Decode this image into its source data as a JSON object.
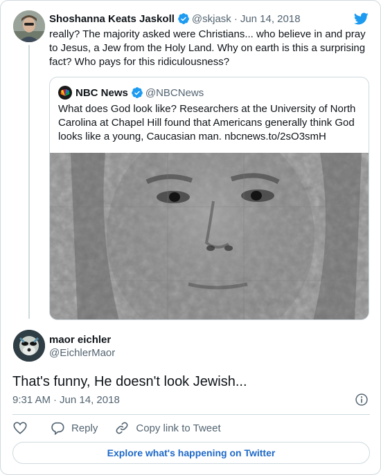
{
  "parent_tweet": {
    "author_name": "Shoshanna Keats Jaskoll",
    "author_handle": "@skjask",
    "date": "Jun 14, 2018",
    "separator": "·",
    "text": "really? The majority asked were Christians... who believe in and pray to Jesus, a Jew from the Holy Land. Why on earth is this a surprising fact? Who pays for this ridiculousness?",
    "icons": {
      "verified": "verified-badge-icon",
      "brand": "twitter-bird-icon"
    }
  },
  "quoted_tweet": {
    "author_name": "NBC News",
    "author_handle": "@NBCNews",
    "text": "What does God look like? Researchers at the University of North Carolina at Chapel Hill found that Americans generally think God looks like a young, Caucasian man. nbcnews.to/2sO3smH",
    "image": "grayscale-composite-face"
  },
  "reply": {
    "author_name": "maor eichler",
    "author_handle": "@EichlerMaor",
    "text": "That's funny, He doesn't look Jewish...",
    "time": "9:31 AM",
    "separator": "·",
    "date": "Jun 14, 2018"
  },
  "actions": {
    "like_icon": "heart-icon",
    "reply_label": "Reply",
    "copy_link_label": "Copy link to Tweet"
  },
  "explore_label": "Explore what's happening on Twitter",
  "colors": {
    "accent": "#1d9bf0",
    "link": "#1d68c8",
    "muted": "#536471",
    "border": "#cfd9de"
  }
}
